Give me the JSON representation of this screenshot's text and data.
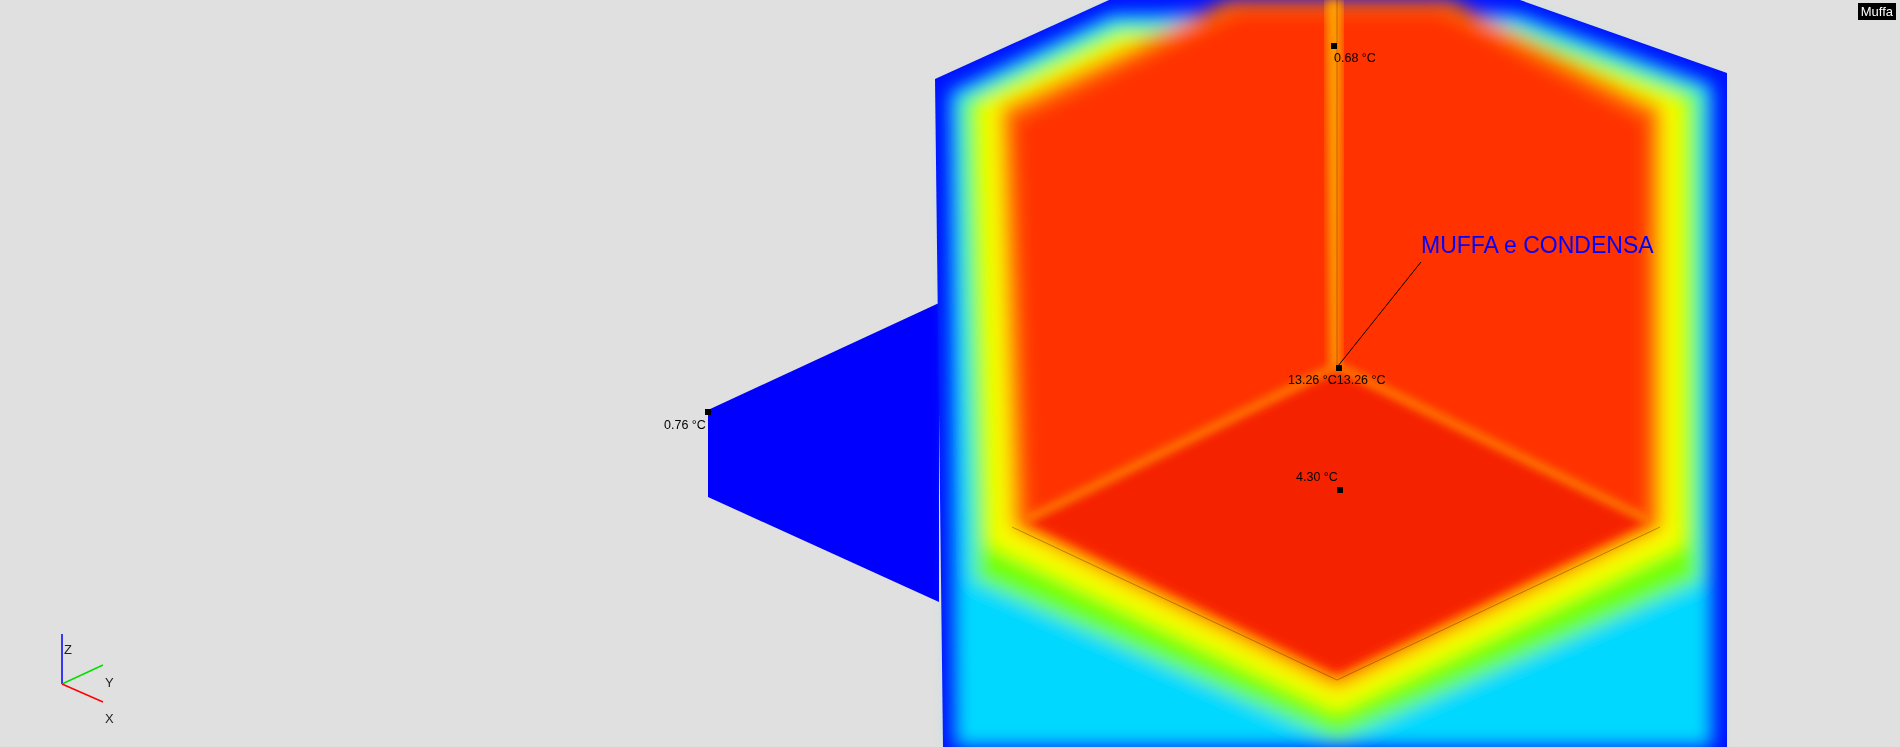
{
  "badge": {
    "text": "Muffa"
  },
  "callout": {
    "text": "MUFFA e CONDENSA"
  },
  "probes": [
    {
      "text": "0.68 °C"
    },
    {
      "text": "13.26 °C13.26 °C"
    },
    {
      "text": "4.30 °C"
    },
    {
      "text": "0.76 °C"
    }
  ],
  "axes": [
    {
      "label": "Z"
    },
    {
      "label": "Y"
    },
    {
      "label": "X"
    }
  ]
}
